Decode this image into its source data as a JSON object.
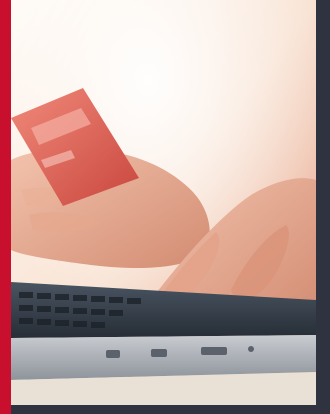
{
  "photo": {
    "subject": "hands-holding-credit-card-typing-on-laptop",
    "icon": "credit-card-laptop-photo"
  },
  "colors": {
    "accent": "#c8102e",
    "background": "#2f3340",
    "card": "#d9534f",
    "laptop": "#3a4350"
  }
}
